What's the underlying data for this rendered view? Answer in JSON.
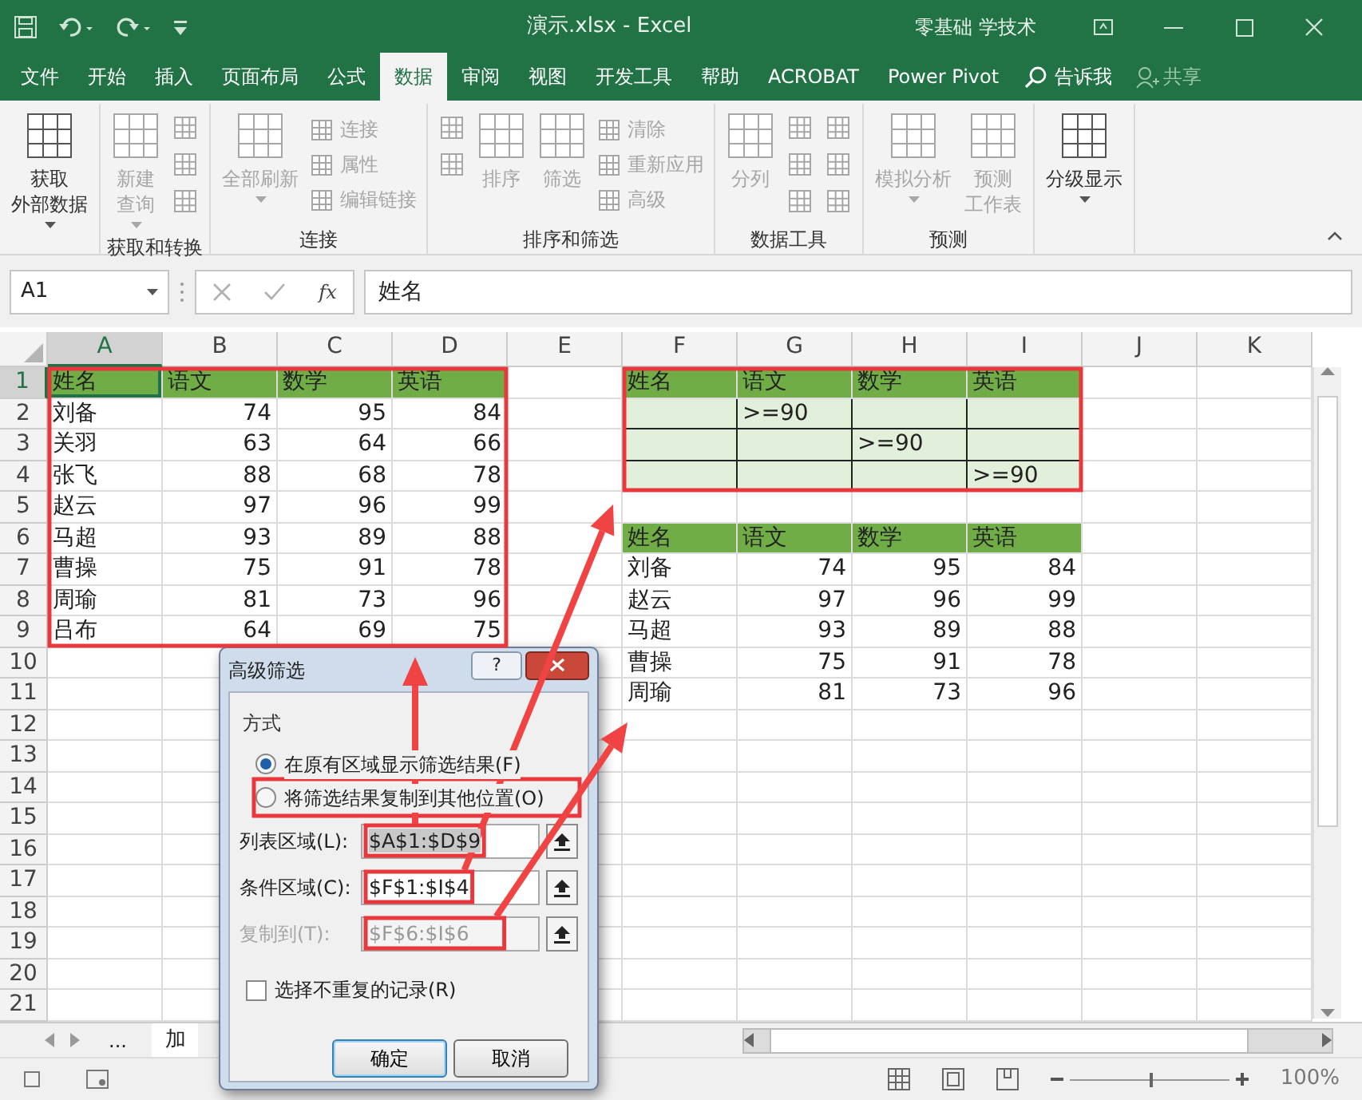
{
  "title_bar": {
    "title": "演示.xlsx - Excel",
    "account": "零基础 学技术"
  },
  "tabs": [
    {
      "label": "文件",
      "selected": false
    },
    {
      "label": "开始",
      "selected": false
    },
    {
      "label": "插入",
      "selected": false
    },
    {
      "label": "页面布局",
      "selected": false
    },
    {
      "label": "公式",
      "selected": false
    },
    {
      "label": "数据",
      "selected": true
    },
    {
      "label": "审阅",
      "selected": false
    },
    {
      "label": "视图",
      "selected": false
    },
    {
      "label": "开发工具",
      "selected": false
    },
    {
      "label": "帮助",
      "selected": false
    },
    {
      "label": "ACROBAT",
      "selected": false
    },
    {
      "label": "Power Pivot",
      "selected": false
    }
  ],
  "tell_me": {
    "label": "告诉我"
  },
  "share": {
    "label": "共享"
  },
  "ribbon": {
    "groups": [
      {
        "items": [
          {
            "kind": "large",
            "lines": [
              "获取",
              "外部数据"
            ],
            "dropdown": true,
            "disabled": false
          }
        ]
      },
      {
        "label": "获取和转换",
        "items": [
          {
            "kind": "large",
            "lines": [
              "新建",
              "查询"
            ],
            "dropdown": true,
            "disabled": true
          },
          {
            "kind": "icon-stack",
            "items": [
              {
                "disabled": true
              },
              {
                "disabled": true
              },
              {
                "disabled": true
              }
            ]
          }
        ]
      },
      {
        "label": "连接",
        "items": [
          {
            "kind": "large",
            "lines": [
              "全部刷新"
            ],
            "dropdown": true,
            "disabled": true
          },
          {
            "kind": "small-stack",
            "items": [
              {
                "label": "连接",
                "disabled": true
              },
              {
                "label": "属性",
                "disabled": true
              },
              {
                "label": "编辑链接",
                "disabled": true
              }
            ]
          }
        ]
      },
      {
        "label": "排序和筛选",
        "items": [
          {
            "kind": "icon-stack",
            "items": [
              {
                "disabled": true
              },
              {
                "disabled": true
              }
            ]
          },
          {
            "kind": "large",
            "lines": [
              "排序"
            ],
            "dropdown": false,
            "disabled": true
          },
          {
            "kind": "large",
            "lines": [
              "筛选"
            ],
            "dropdown": false,
            "disabled": true
          },
          {
            "kind": "small-stack",
            "items": [
              {
                "label": "清除",
                "disabled": true
              },
              {
                "label": "重新应用",
                "disabled": true
              },
              {
                "label": "高级",
                "disabled": true
              }
            ]
          }
        ]
      },
      {
        "label": "数据工具",
        "items": [
          {
            "kind": "large",
            "lines": [
              "分列"
            ],
            "dropdown": false,
            "disabled": true
          },
          {
            "kind": "icon-stack",
            "items": [
              {
                "disabled": true
              },
              {
                "disabled": true
              },
              {
                "disabled": true
              }
            ]
          },
          {
            "kind": "icon-stack",
            "items": [
              {
                "disabled": true
              },
              {
                "disabled": true
              },
              {
                "disabled": true
              }
            ]
          }
        ]
      },
      {
        "label": "预测",
        "items": [
          {
            "kind": "large",
            "lines": [
              "模拟分析"
            ],
            "dropdown": true,
            "disabled": true
          },
          {
            "kind": "large",
            "lines": [
              "预测",
              "工作表"
            ],
            "dropdown": false,
            "disabled": true
          }
        ]
      },
      {
        "items": [
          {
            "kind": "large",
            "lines": [
              "分级显示"
            ],
            "dropdown": true,
            "disabled": false
          }
        ]
      }
    ]
  },
  "formula_bar": {
    "name_box": "A1",
    "function_label": "fx",
    "formula": "姓名"
  },
  "sheet": {
    "columns": [
      {
        "label": "A",
        "selected": true
      },
      {
        "label": "B",
        "selected": false
      },
      {
        "label": "C",
        "selected": false
      },
      {
        "label": "D",
        "selected": false
      },
      {
        "label": "E",
        "selected": false
      },
      {
        "label": "F",
        "selected": false
      },
      {
        "label": "G",
        "selected": false
      },
      {
        "label": "H",
        "selected": false
      },
      {
        "label": "I",
        "selected": false
      },
      {
        "label": "J",
        "selected": false
      },
      {
        "label": "K",
        "selected": false
      }
    ],
    "rows": [
      {
        "number": "1",
        "selected": true,
        "cells": [
          {
            "kind": "header",
            "text": "姓名"
          },
          {
            "kind": "header",
            "text": "语文"
          },
          {
            "kind": "header",
            "text": "数学"
          },
          {
            "kind": "header",
            "text": "英语"
          },
          null,
          {
            "kind": "header",
            "text": "姓名"
          },
          {
            "kind": "header",
            "text": "语文"
          },
          {
            "kind": "header",
            "text": "数学"
          },
          {
            "kind": "header",
            "text": "英语"
          },
          null,
          null
        ]
      },
      {
        "number": "2",
        "selected": false,
        "cells": [
          {
            "kind": "text",
            "text": "刘备"
          },
          {
            "kind": "number",
            "text": "74"
          },
          {
            "kind": "number",
            "text": "95"
          },
          {
            "kind": "number",
            "text": "84"
          },
          null,
          {
            "kind": "criteria"
          },
          {
            "kind": "criteria",
            "text": ">=90"
          },
          {
            "kind": "criteria"
          },
          {
            "kind": "criteria"
          },
          null,
          null
        ]
      },
      {
        "number": "3",
        "selected": false,
        "cells": [
          {
            "kind": "text",
            "text": "关羽"
          },
          {
            "kind": "number",
            "text": "63"
          },
          {
            "kind": "number",
            "text": "64"
          },
          {
            "kind": "number",
            "text": "66"
          },
          null,
          {
            "kind": "criteria"
          },
          {
            "kind": "criteria"
          },
          {
            "kind": "criteria",
            "text": ">=90"
          },
          {
            "kind": "criteria"
          },
          null,
          null
        ]
      },
      {
        "number": "4",
        "selected": false,
        "cells": [
          {
            "kind": "text",
            "text": "张飞"
          },
          {
            "kind": "number",
            "text": "88"
          },
          {
            "kind": "number",
            "text": "68"
          },
          {
            "kind": "number",
            "text": "78"
          },
          null,
          {
            "kind": "criteria"
          },
          {
            "kind": "criteria"
          },
          {
            "kind": "criteria"
          },
          {
            "kind": "criteria",
            "text": ">=90"
          },
          null,
          null
        ]
      },
      {
        "number": "5",
        "selected": false,
        "cells": [
          {
            "kind": "text",
            "text": "赵云"
          },
          {
            "kind": "number",
            "text": "97"
          },
          {
            "kind": "number",
            "text": "96"
          },
          {
            "kind": "number",
            "text": "99"
          },
          null,
          null,
          null,
          null,
          null,
          null,
          null
        ]
      },
      {
        "number": "6",
        "selected": false,
        "cells": [
          {
            "kind": "text",
            "text": "马超"
          },
          {
            "kind": "number",
            "text": "93"
          },
          {
            "kind": "number",
            "text": "89"
          },
          {
            "kind": "number",
            "text": "88"
          },
          null,
          {
            "kind": "header",
            "text": "姓名"
          },
          {
            "kind": "header",
            "text": "语文"
          },
          {
            "kind": "header",
            "text": "数学"
          },
          {
            "kind": "header",
            "text": "英语"
          },
          null,
          null
        ]
      },
      {
        "number": "7",
        "selected": false,
        "cells": [
          {
            "kind": "text",
            "text": "曹操"
          },
          {
            "kind": "number",
            "text": "75"
          },
          {
            "kind": "number",
            "text": "91"
          },
          {
            "kind": "number",
            "text": "78"
          },
          null,
          {
            "kind": "text",
            "text": "刘备"
          },
          {
            "kind": "number",
            "text": "74"
          },
          {
            "kind": "number",
            "text": "95"
          },
          {
            "kind": "number",
            "text": "84"
          },
          null,
          null
        ]
      },
      {
        "number": "8",
        "selected": false,
        "cells": [
          {
            "kind": "text",
            "text": "周瑜"
          },
          {
            "kind": "number",
            "text": "81"
          },
          {
            "kind": "number",
            "text": "73"
          },
          {
            "kind": "number",
            "text": "96"
          },
          null,
          {
            "kind": "text",
            "text": "赵云"
          },
          {
            "kind": "number",
            "text": "97"
          },
          {
            "kind": "number",
            "text": "96"
          },
          {
            "kind": "number",
            "text": "99"
          },
          null,
          null
        ]
      },
      {
        "number": "9",
        "selected": false,
        "cells": [
          {
            "kind": "text",
            "text": "吕布"
          },
          {
            "kind": "number",
            "text": "64"
          },
          {
            "kind": "number",
            "text": "69"
          },
          {
            "kind": "number",
            "text": "75"
          },
          null,
          {
            "kind": "text",
            "text": "马超"
          },
          {
            "kind": "number",
            "text": "93"
          },
          {
            "kind": "number",
            "text": "89"
          },
          {
            "kind": "number",
            "text": "88"
          },
          null,
          null
        ]
      },
      {
        "number": "10",
        "selected": false,
        "cells": [
          null,
          null,
          null,
          null,
          null,
          {
            "kind": "text",
            "text": "曹操"
          },
          {
            "kind": "number",
            "text": "75"
          },
          {
            "kind": "number",
            "text": "91"
          },
          {
            "kind": "number",
            "text": "78"
          },
          null,
          null
        ]
      },
      {
        "number": "11",
        "selected": false,
        "cells": [
          null,
          null,
          null,
          null,
          null,
          {
            "kind": "text",
            "text": "周瑜"
          },
          {
            "kind": "number",
            "text": "81"
          },
          {
            "kind": "number",
            "text": "73"
          },
          {
            "kind": "number",
            "text": "96"
          },
          null,
          null
        ]
      },
      {
        "number": "12",
        "selected": false
      },
      {
        "number": "13",
        "selected": false
      },
      {
        "number": "14",
        "selected": false
      },
      {
        "number": "15",
        "selected": false
      },
      {
        "number": "16",
        "selected": false
      },
      {
        "number": "17",
        "selected": false
      },
      {
        "number": "18",
        "selected": false
      },
      {
        "number": "19",
        "selected": false
      },
      {
        "number": "20",
        "selected": false
      },
      {
        "number": "21",
        "selected": false
      }
    ]
  },
  "sheet_tabs": {
    "overflow": "...",
    "tabs": [
      {
        "label": "加"
      }
    ]
  },
  "status_bar": {
    "zoom": {
      "level": 0.5,
      "reading": "100%"
    }
  },
  "dialog": {
    "title": "高级筛选",
    "help": "?",
    "section": "方式",
    "options": [
      {
        "label": "在原有区域显示筛选结果(F)",
        "selected": true
      },
      {
        "label": "将筛选结果复制到其他位置(O)",
        "selected": false
      }
    ],
    "fields": [
      {
        "label": "列表区域(L):",
        "value": "$A$1:$D$9",
        "disabled": false,
        "text_selected": true
      },
      {
        "label": "条件区域(C):",
        "value": "$F$1:$I$4",
        "disabled": false,
        "text_selected": false
      },
      {
        "label": "复制到(T):",
        "value": "$F$6:$I$6",
        "disabled": true,
        "text_selected": false
      }
    ],
    "checkbox": {
      "label": "选择不重复的记录(R)",
      "checked": false
    },
    "buttons": [
      {
        "label": "确定",
        "default": true
      },
      {
        "label": "取消",
        "default": false
      }
    ]
  }
}
